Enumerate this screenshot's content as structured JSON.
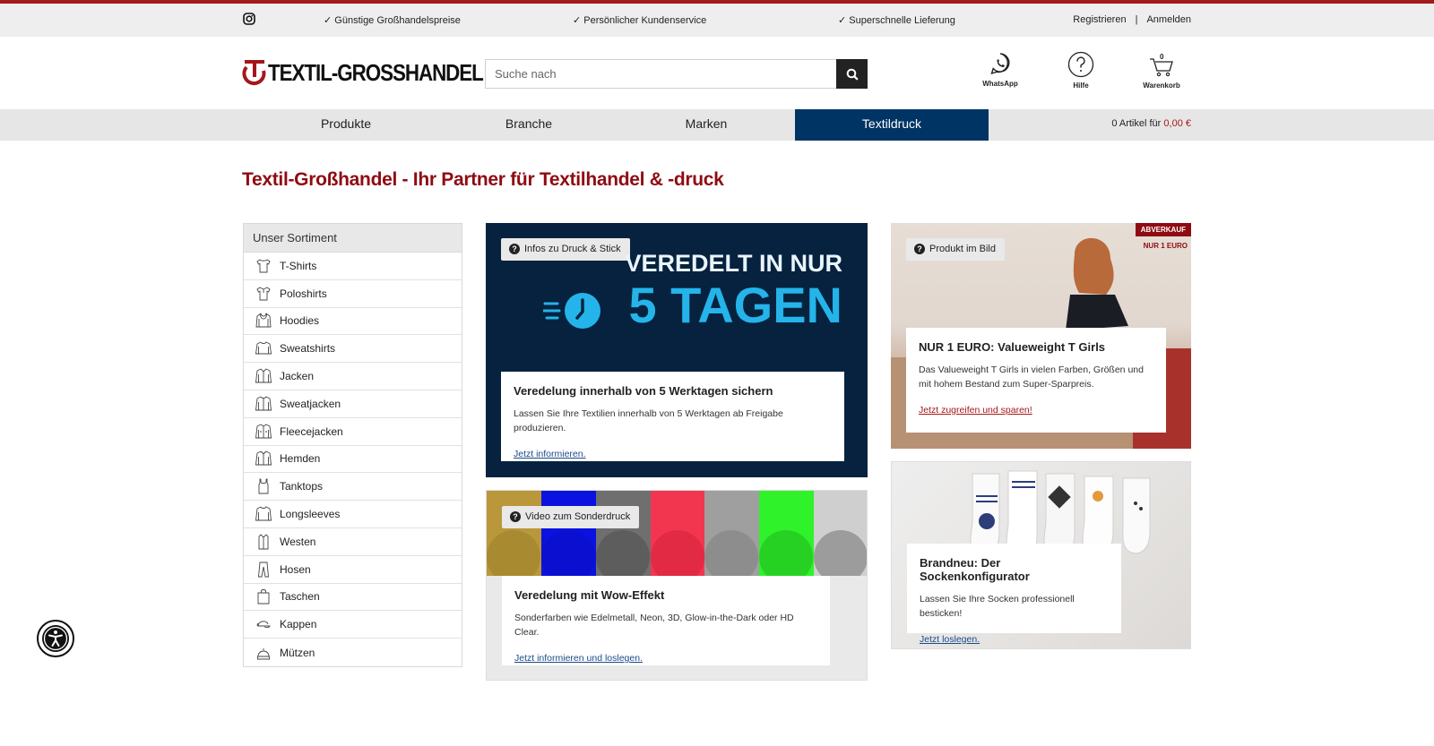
{
  "topbar": {
    "usps": [
      "✓ Günstige Großhandelspreise",
      "✓ Persönlicher Kundenservice",
      "✓ Superschnelle Lieferung"
    ],
    "register": "Registrieren",
    "separator": "|",
    "login": "Anmelden"
  },
  "header": {
    "logo_text": "TEXTIL-GROSSHANDEL",
    "search_placeholder": "Suche nach",
    "whatsapp_label": "WhatsApp",
    "help_label": "Hilfe",
    "cart_label": "Warenkorb",
    "cart_count": "0"
  },
  "nav": {
    "items": [
      "Produkte",
      "Branche",
      "Marken",
      "Textildruck"
    ],
    "active": "Textildruck",
    "cart_summary": "0 Artikel für",
    "cart_price": "0,00 €"
  },
  "page_title": "Textil-Großhandel - Ihr Partner für Textilhandel & -druck",
  "sidebar": {
    "title": "Unser Sortiment",
    "items": [
      "T-Shirts",
      "Poloshirts",
      "Hoodies",
      "Sweatshirts",
      "Jacken",
      "Sweatjacken",
      "Fleecejacken",
      "Hemden",
      "Tanktops",
      "Longsleeves",
      "Westen",
      "Hosen",
      "Taschen",
      "Kappen",
      "Mützen"
    ]
  },
  "tiles": {
    "t1": {
      "pill": "Infos zu Druck & Stick",
      "banner_line1": "VEREDELT IN NUR",
      "banner_line2": "5 TAGEN",
      "title": "Veredelung innerhalb von 5 Werktagen sichern",
      "text": "Lassen Sie Ihre Textilien innerhalb von 5 Werktagen ab Freigabe produzieren.",
      "link": "Jetzt informieren."
    },
    "t2": {
      "pill": "Produkt im Bild",
      "badge": "ABVERKAUF",
      "badge_sub": "NUR 1 EURO",
      "title": "NUR 1 EURO: Valueweight T Girls",
      "text": "Das Valueweight T Girls in vielen Farben, Größen und mit hohem Bestand zum Super-Sparpreis.",
      "link": "Jetzt zugreifen und sparen!"
    },
    "t3": {
      "pill": "Video zum Sonderdruck",
      "title": "Veredelung mit Wow-Effekt",
      "text": "Sonderfarben wie Edelmetall, Neon, 3D, Glow-in-the-Dark oder HD Clear.",
      "link": "Jetzt informieren und loslegen."
    },
    "t4": {
      "title": "Brandneu: Der Sockenkonfigurator",
      "text": "Lassen Sie Ihre Socken professionell besticken!",
      "link": "Jetzt loslegen."
    }
  },
  "colors": {
    "brand_red": "#a4171b",
    "title_red": "#8f0b12",
    "nav_active": "#003465",
    "banner_bg": "#06223f",
    "banner_accent": "#24b4ea",
    "swatches": [
      "#b9973a",
      "#0b12e0",
      "#6f6f6f",
      "#f3364f",
      "#9f9f9f",
      "#2ff22b",
      "#cfcfcf"
    ]
  },
  "icons": [
    "instagram-icon",
    "search-icon",
    "whatsapp-icon",
    "help-icon",
    "cart-icon",
    "question-icon",
    "accessibility-icon"
  ]
}
